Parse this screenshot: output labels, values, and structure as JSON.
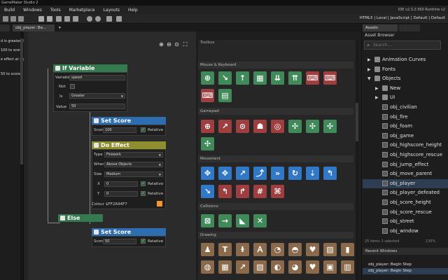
{
  "titlebar": {
    "title": "GameMaker Studio 2"
  },
  "menu": [
    "Build",
    "Windows",
    "Tools",
    "Marketplace",
    "Layouts",
    "Help"
  ],
  "toolbar": {
    "ide_version": "IDE v2.3.2.560  Runtime v2",
    "target": "HTML5 | Local | JavaScript | Default | Default"
  },
  "tabs": [
    {
      "label": ""
    },
    {
      "label": "obj_player: Be..."
    }
  ],
  "left_panel": {
    "items": [
      "d is greater th",
      "100 to score",
      "e effect at x,y",
      "50 to score"
    ]
  },
  "canvas": {
    "zoom_icons": [
      "zoom-in-icon",
      "zoom-out-icon",
      "zoom-reset-icon",
      "fit-icon"
    ],
    "if_variable": {
      "title": "If Variable",
      "variable_label": "Variable",
      "variable_value": "speed",
      "not_label": "Not",
      "is_label": "Is",
      "is_value": "Greater",
      "value_label": "Value",
      "value_value": "50"
    },
    "set_score_1": {
      "title": "Set Score",
      "score_label": "Score",
      "score_value": "100",
      "relative_label": "Relative"
    },
    "do_effect": {
      "title": "Do Effect",
      "type_label": "Type",
      "type_value": "Firework",
      "where_label": "Where",
      "where_value": "Above Objects",
      "size_label": "Size",
      "size_value": "Medium",
      "x_label": "X",
      "x_value": "0",
      "y_label": "Y",
      "y_value": "0",
      "colour_label": "Colour",
      "colour_value": "$FF2A94F7",
      "relative_label": "Relative",
      "colour_swatch": "#f7942a"
    },
    "else_block": {
      "title": "Else"
    },
    "set_score_2": {
      "title": "Set Score",
      "score_label": "Score",
      "score_value": "50",
      "relative_label": "Relative"
    }
  },
  "toolbox": {
    "title": "Toolbox",
    "sections": [
      {
        "name": "Mouse & Keyboard"
      },
      {
        "name": "Gamepad"
      },
      {
        "name": "Movement"
      },
      {
        "name": "Collisions"
      },
      {
        "name": "Drawing"
      }
    ]
  },
  "right_panel": {
    "tabs": [
      "Assets",
      ""
    ],
    "title": "Asset Browser",
    "search_placeholder": "Search...",
    "assets": [
      {
        "label": "Animation Curves",
        "kind": "folder"
      },
      {
        "label": "Fonts",
        "kind": "folder"
      },
      {
        "label": "Objects",
        "kind": "folder-open"
      },
      {
        "label": "New",
        "kind": "folder"
      },
      {
        "label": "UI",
        "kind": "folder"
      },
      {
        "label": "obj_civilian",
        "kind": "object"
      },
      {
        "label": "obj_fire",
        "kind": "object"
      },
      {
        "label": "obj_foam",
        "kind": "object"
      },
      {
        "label": "obj_game",
        "kind": "object"
      },
      {
        "label": "obj_highscore_height",
        "kind": "object"
      },
      {
        "label": "obj_highscore_rescue",
        "kind": "object"
      },
      {
        "label": "obj_jump_effect",
        "kind": "object"
      },
      {
        "label": "obj_move_parent",
        "kind": "object"
      },
      {
        "label": "obj_player",
        "kind": "object"
      },
      {
        "label": "obj_player_defeated",
        "kind": "object"
      },
      {
        "label": "obj_score_height",
        "kind": "object"
      },
      {
        "label": "obj_score_rescue",
        "kind": "object"
      },
      {
        "label": "obj_street",
        "kind": "object"
      },
      {
        "label": "obj_window",
        "kind": "object"
      }
    ],
    "status": "25 items    1 selected",
    "zoom": "135%",
    "recent_title": "Recent Windows",
    "recent": [
      "obj_player: Begin Step",
      "obj_player: Begin Step"
    ]
  }
}
